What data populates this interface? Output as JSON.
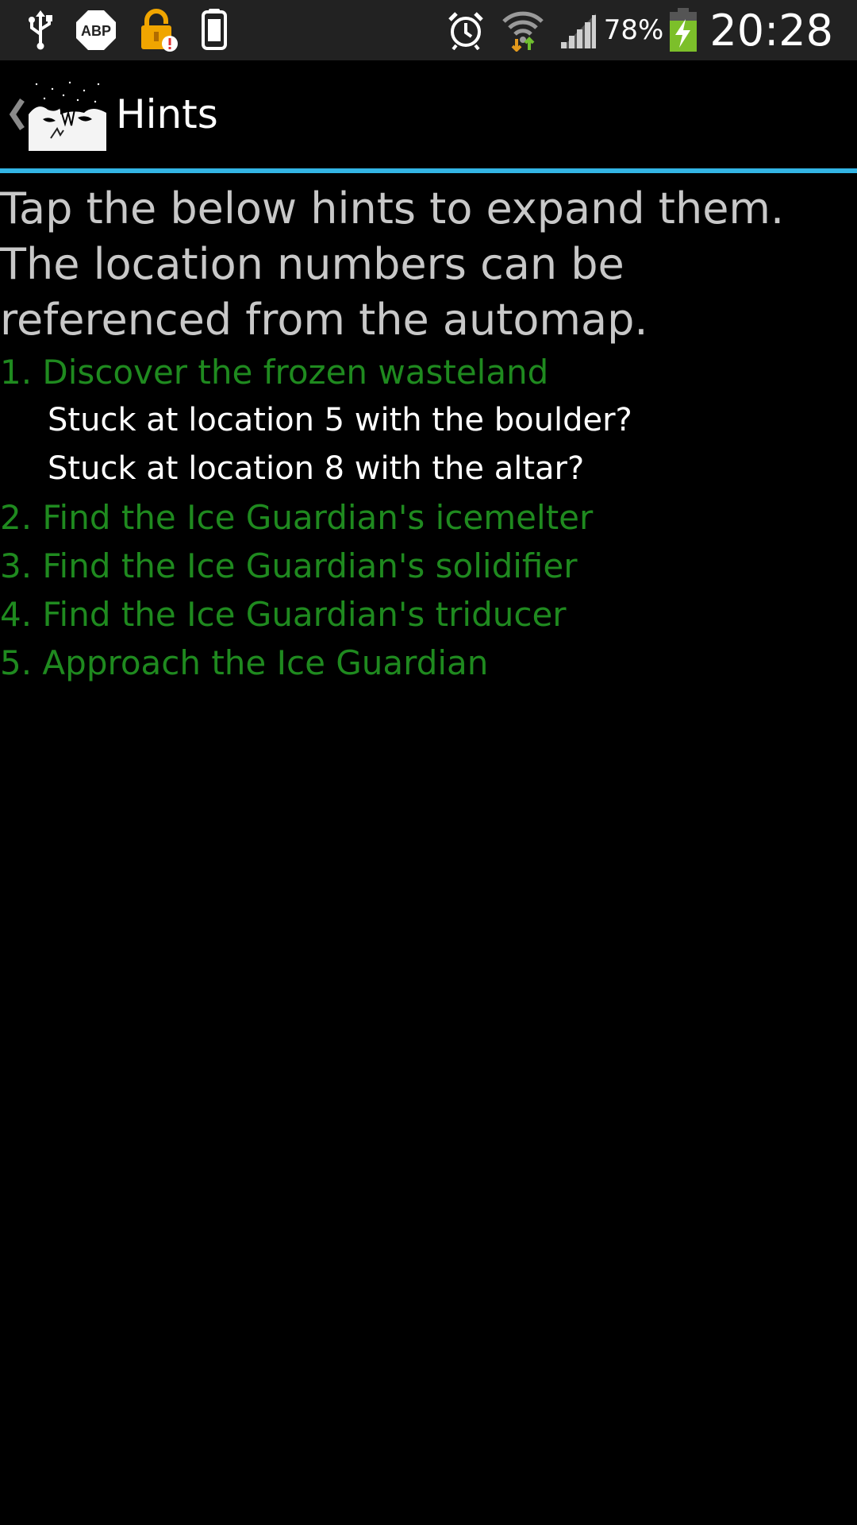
{
  "status_bar": {
    "left_icons": [
      "usb-icon",
      "adblock-plus-icon",
      "lock-warning-icon",
      "phone-vibrate-icon"
    ],
    "adblock_text": "ABP",
    "right_icons": [
      "alarm-icon",
      "wifi-icon",
      "signal-icon"
    ],
    "battery_percent": "78%",
    "battery_level": 0.78,
    "time": "20:28"
  },
  "action_bar": {
    "title": "Hints",
    "accent_color": "#33b5e5"
  },
  "content": {
    "intro": "Tap the below hints to expand them.\nThe location numbers can be\nreferenced from the automap.",
    "hint_groups": [
      {
        "heading": "1. Discover the frozen wasteland",
        "expanded": true,
        "subhints": [
          "Stuck at location 5 with the boulder?",
          "Stuck at location 8 with the altar?"
        ]
      },
      {
        "heading": "2. Find the Ice Guardian's icemelter",
        "expanded": false,
        "subhints": []
      },
      {
        "heading": "3. Find the Ice Guardian's solidifier",
        "expanded": false,
        "subhints": []
      },
      {
        "heading": "4. Find the Ice Guardian's triducer",
        "expanded": false,
        "subhints": []
      },
      {
        "heading": "5. Approach the Ice Guardian",
        "expanded": false,
        "subhints": []
      }
    ],
    "heading_color": "#1f8a1f"
  }
}
